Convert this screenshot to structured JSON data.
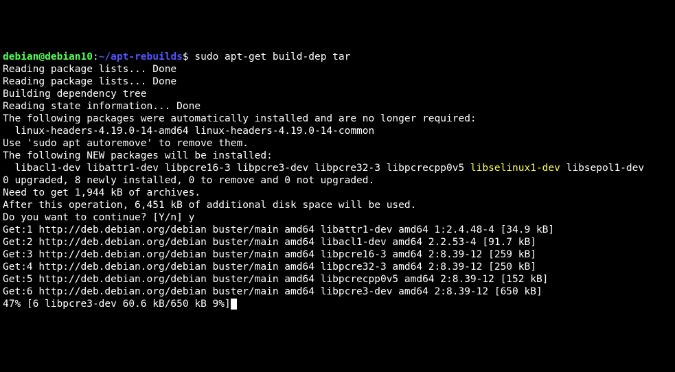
{
  "prompt": {
    "user": "debian",
    "at": "@",
    "host": "debian10",
    "colon": ":",
    "path": "~/apt-rebuilds",
    "dollar": "$ ",
    "command": "sudo apt-get build-dep tar"
  },
  "lines": {
    "l1": "Reading package lists... Done",
    "l2": "Reading package lists... Done",
    "l3": "Building dependency tree",
    "l4": "Reading state information... Done",
    "l5": "The following packages were automatically installed and are no longer required:",
    "l6": "  linux-headers-4.19.0-14-amd64 linux-headers-4.19.0-14-common",
    "l7": "Use 'sudo apt autoremove' to remove them.",
    "l8": "The following NEW packages will be installed:",
    "l9a": "  libacl1-dev libattr1-dev libpcre16-3 libpcre3-dev libpcre32-3 libpcrecpp0v5 ",
    "l9b": "libselinux1-dev",
    "l9c": " libsepol1-dev",
    "l10": "0 upgraded, 8 newly installed, 0 to remove and 0 not upgraded.",
    "l11": "Need to get 1,944 kB of archives.",
    "l12": "After this operation, 6,451 kB of additional disk space will be used.",
    "l13": "Do you want to continue? [Y/n] y",
    "l14": "Get:1 http://deb.debian.org/debian buster/main amd64 libattr1-dev amd64 1:2.4.48-4 [34.9 kB]",
    "l15": "Get:2 http://deb.debian.org/debian buster/main amd64 libacl1-dev amd64 2.2.53-4 [91.7 kB]",
    "l16": "Get:3 http://deb.debian.org/debian buster/main amd64 libpcre16-3 amd64 2:8.39-12 [259 kB]",
    "l17": "Get:4 http://deb.debian.org/debian buster/main amd64 libpcre32-3 amd64 2:8.39-12 [250 kB]",
    "l18": "Get:5 http://deb.debian.org/debian buster/main amd64 libpcrecpp0v5 amd64 2:8.39-12 [152 kB]",
    "l19": "Get:6 http://deb.debian.org/debian buster/main amd64 libpcre3-dev amd64 2:8.39-12 [650 kB]",
    "l20": "47% [6 libpcre3-dev 60.6 kB/650 kB 9%]"
  }
}
